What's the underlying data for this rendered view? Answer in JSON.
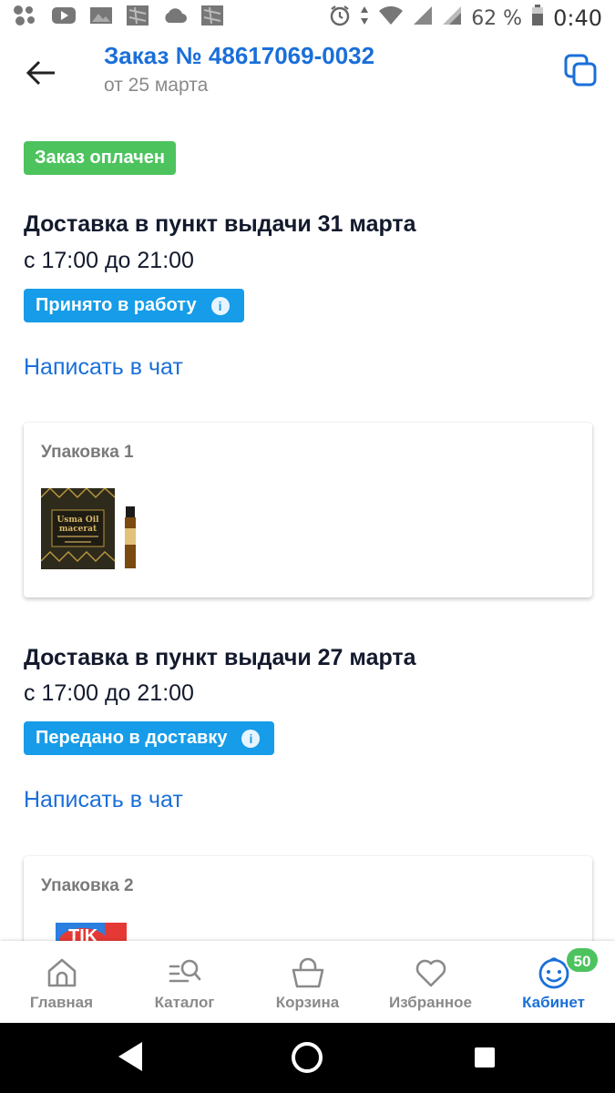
{
  "status_bar": {
    "battery": "62 %",
    "time": "0:40"
  },
  "header": {
    "title": "Заказ № 48617069-0032",
    "subtitle": "от 25 марта"
  },
  "order": {
    "paid_label": "Заказ оплачен"
  },
  "deliveries": [
    {
      "title": "Доставка в пункт выдачи 31 марта",
      "time": "с 17:00 до 21:00",
      "status": "Принято в работу",
      "chat_link": "Написать в чат",
      "package_title": "Упаковка 1"
    },
    {
      "title": "Доставка в пункт выдачи 27 марта",
      "time": "с 17:00 до 21:00",
      "status": "Передано в доставку",
      "chat_link": "Написать в чат",
      "package_title": "Упаковка 2"
    }
  ],
  "products": {
    "thumb1_text": "Usma Oil macerat",
    "thumb2_text": "TIK"
  },
  "bottom_nav": {
    "items": [
      {
        "label": "Главная",
        "icon": "home-icon"
      },
      {
        "label": "Каталог",
        "icon": "catalog-search-icon"
      },
      {
        "label": "Корзина",
        "icon": "basket-icon"
      },
      {
        "label": "Избранное",
        "icon": "heart-icon"
      },
      {
        "label": "Кабинет",
        "icon": "smiley-icon"
      }
    ],
    "badge": "50"
  },
  "colors": {
    "brand_blue": "#1a6fd9",
    "status_blue": "#169ce8",
    "paid_green": "#4dc35e"
  }
}
